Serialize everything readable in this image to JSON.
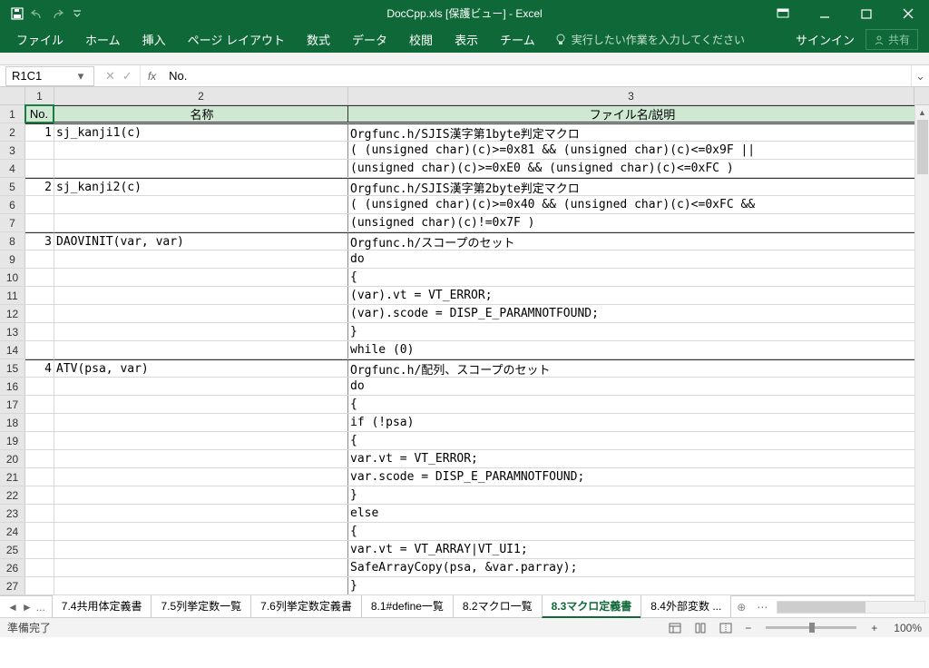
{
  "titlebar": {
    "title": "DocCpp.xls  [保護ビュー] - Excel"
  },
  "ribbon": {
    "tabs": [
      "ファイル",
      "ホーム",
      "挿入",
      "ページ レイアウト",
      "数式",
      "データ",
      "校閲",
      "表示",
      "チーム"
    ],
    "tell_me": "実行したい作業を入力してください",
    "signin": "サインイン",
    "share": "共有"
  },
  "formula_bar": {
    "name_box": "R1C1",
    "fx_label": "fx",
    "value": "No."
  },
  "col_headers": [
    "1",
    "2",
    "3"
  ],
  "rows": [
    {
      "n": "1",
      "c1": "No.",
      "c2": "名称",
      "c3": "ファイル名/説明",
      "hdr": true
    },
    {
      "n": "2",
      "c1": "1",
      "c2": "sj_kanji1(c)",
      "c3": "Orgfunc.h/SJIS漢字第1byte判定マクロ",
      "gs": true
    },
    {
      "n": "3",
      "c1": "",
      "c2": "",
      "c3": "  ( (unsigned char)(c)>=0x81 && (unsigned char)(c)<=0x9F ||"
    },
    {
      "n": "4",
      "c1": "",
      "c2": "",
      "c3": "    (unsigned char)(c)>=0xE0 && (unsigned char)(c)<=0xFC )"
    },
    {
      "n": "5",
      "c1": "2",
      "c2": "sj_kanji2(c)",
      "c3": "Orgfunc.h/SJIS漢字第2byte判定マクロ",
      "gs": true
    },
    {
      "n": "6",
      "c1": "",
      "c2": "",
      "c3": "  ( (unsigned char)(c)>=0x40 && (unsigned char)(c)<=0xFC &&"
    },
    {
      "n": "7",
      "c1": "",
      "c2": "",
      "c3": "    (unsigned char)(c)!=0x7F )"
    },
    {
      "n": "8",
      "c1": "3",
      "c2": "DAOVINIT(var, var)",
      "c3": "Orgfunc.h/スコープのセット",
      "gs": true
    },
    {
      "n": "9",
      "c1": "",
      "c2": "",
      "c3": "    do"
    },
    {
      "n": "10",
      "c1": "",
      "c2": "",
      "c3": "    {"
    },
    {
      "n": "11",
      "c1": "",
      "c2": "",
      "c3": "    (var).vt = VT_ERROR;"
    },
    {
      "n": "12",
      "c1": "",
      "c2": "",
      "c3": "    (var).scode = DISP_E_PARAMNOTFOUND;"
    },
    {
      "n": "13",
      "c1": "",
      "c2": "",
      "c3": "    }"
    },
    {
      "n": "14",
      "c1": "",
      "c2": "",
      "c3": "    while (0)"
    },
    {
      "n": "15",
      "c1": "4",
      "c2": "ATV(psa, var)",
      "c3": "Orgfunc.h/配列、スコープのセット",
      "gs": true
    },
    {
      "n": "16",
      "c1": "",
      "c2": "",
      "c3": "    do"
    },
    {
      "n": "17",
      "c1": "",
      "c2": "",
      "c3": "    {"
    },
    {
      "n": "18",
      "c1": "",
      "c2": "",
      "c3": "    if (!psa)"
    },
    {
      "n": "19",
      "c1": "",
      "c2": "",
      "c3": "    {"
    },
    {
      "n": "20",
      "c1": "",
      "c2": "",
      "c3": "    var.vt  = VT_ERROR;"
    },
    {
      "n": "21",
      "c1": "",
      "c2": "",
      "c3": "    var.scode = DISP_E_PARAMNOTFOUND;"
    },
    {
      "n": "22",
      "c1": "",
      "c2": "",
      "c3": "    }"
    },
    {
      "n": "23",
      "c1": "",
      "c2": "",
      "c3": "    else"
    },
    {
      "n": "24",
      "c1": "",
      "c2": "",
      "c3": "    {"
    },
    {
      "n": "25",
      "c1": "",
      "c2": "",
      "c3": "    var.vt  = VT_ARRAY|VT_UI1;"
    },
    {
      "n": "26",
      "c1": "",
      "c2": "",
      "c3": "    SafeArrayCopy(psa, &var.parray);"
    },
    {
      "n": "27",
      "c1": "",
      "c2": "",
      "c3": "    }"
    }
  ],
  "sheet_tabs": {
    "ellipsis": "...",
    "tabs": [
      {
        "label": "7.4共用体定義書",
        "active": false
      },
      {
        "label": "7.5列挙定数一覧",
        "active": false
      },
      {
        "label": "7.6列挙定数定義書",
        "active": false
      },
      {
        "label": "8.1#define一覧",
        "active": false
      },
      {
        "label": "8.2マクロ一覧",
        "active": false
      },
      {
        "label": "8.3マクロ定義書",
        "active": true
      },
      {
        "label": "8.4外部変数 ...",
        "active": false
      }
    ]
  },
  "status_bar": {
    "ready": "準備完了",
    "zoom": "100%"
  }
}
